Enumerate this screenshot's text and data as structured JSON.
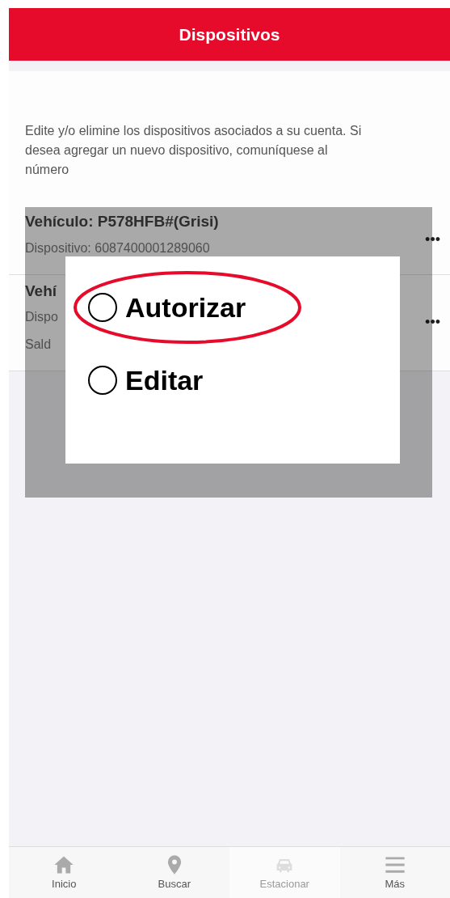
{
  "header": {
    "title": "Dispositivos"
  },
  "intro": "Edite y/o elimine los dispositivos asociados a su cuenta. Si desea agregar un nuevo dispositivo, comuníquese al número",
  "devices": [
    {
      "lines": [
        "Vehículo: P578HFB#(Grisi)",
        "Dispositivo: 6087400001289060"
      ],
      "menu": "•••"
    },
    {
      "lines": [
        "Vehí",
        "Dispo",
        "Sald"
      ],
      "menu": "•••"
    }
  ],
  "popup": {
    "options": [
      {
        "label": "Autorizar",
        "selected": false,
        "highlighted": true
      },
      {
        "label": "Editar",
        "selected": false,
        "highlighted": false
      }
    ]
  },
  "tab_bar": [
    {
      "label": "Inicio",
      "kind": "home",
      "disabled": false
    },
    {
      "label": "Buscar",
      "kind": "pin",
      "disabled": false
    },
    {
      "label": "Estacionar",
      "kind": "car",
      "disabled": true
    },
    {
      "label": "Más",
      "kind": "menu",
      "disabled": false
    }
  ]
}
